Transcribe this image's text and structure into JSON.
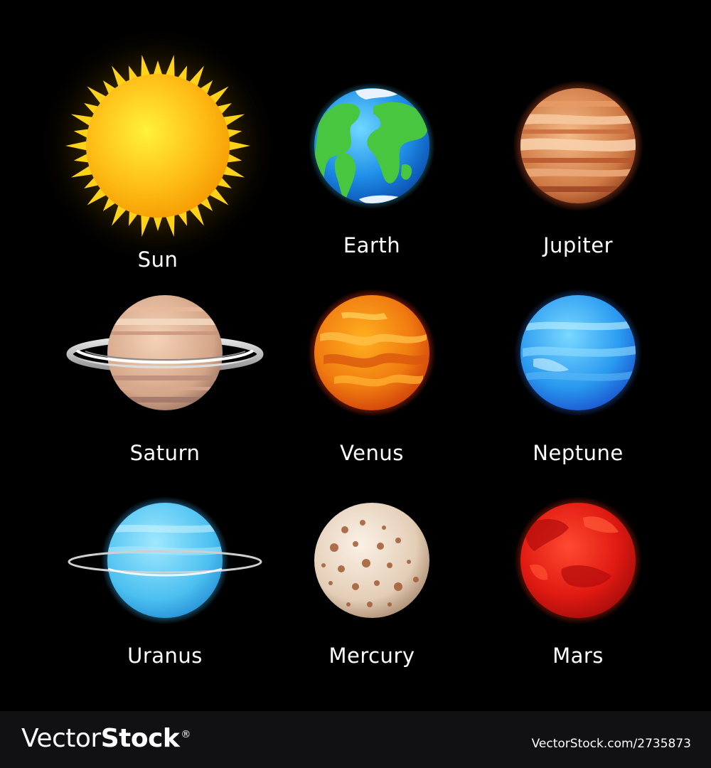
{
  "planets": [
    {
      "key": "sun",
      "name": "Sun"
    },
    {
      "key": "earth",
      "name": "Earth"
    },
    {
      "key": "jupiter",
      "name": "Jupiter"
    },
    {
      "key": "saturn",
      "name": "Saturn"
    },
    {
      "key": "venus",
      "name": "Venus"
    },
    {
      "key": "neptune",
      "name": "Neptune"
    },
    {
      "key": "uranus",
      "name": "Uranus"
    },
    {
      "key": "mercury",
      "name": "Mercury"
    },
    {
      "key": "mars",
      "name": "Mars"
    }
  ],
  "footer": {
    "brand_part1": "Vector",
    "brand_part2": "Stock",
    "brand_reg": "®",
    "credit": "VectorStock.com/2735873"
  },
  "colors": {
    "background": "#000000",
    "footer_bg": "#111114",
    "text": "#ffffff"
  }
}
